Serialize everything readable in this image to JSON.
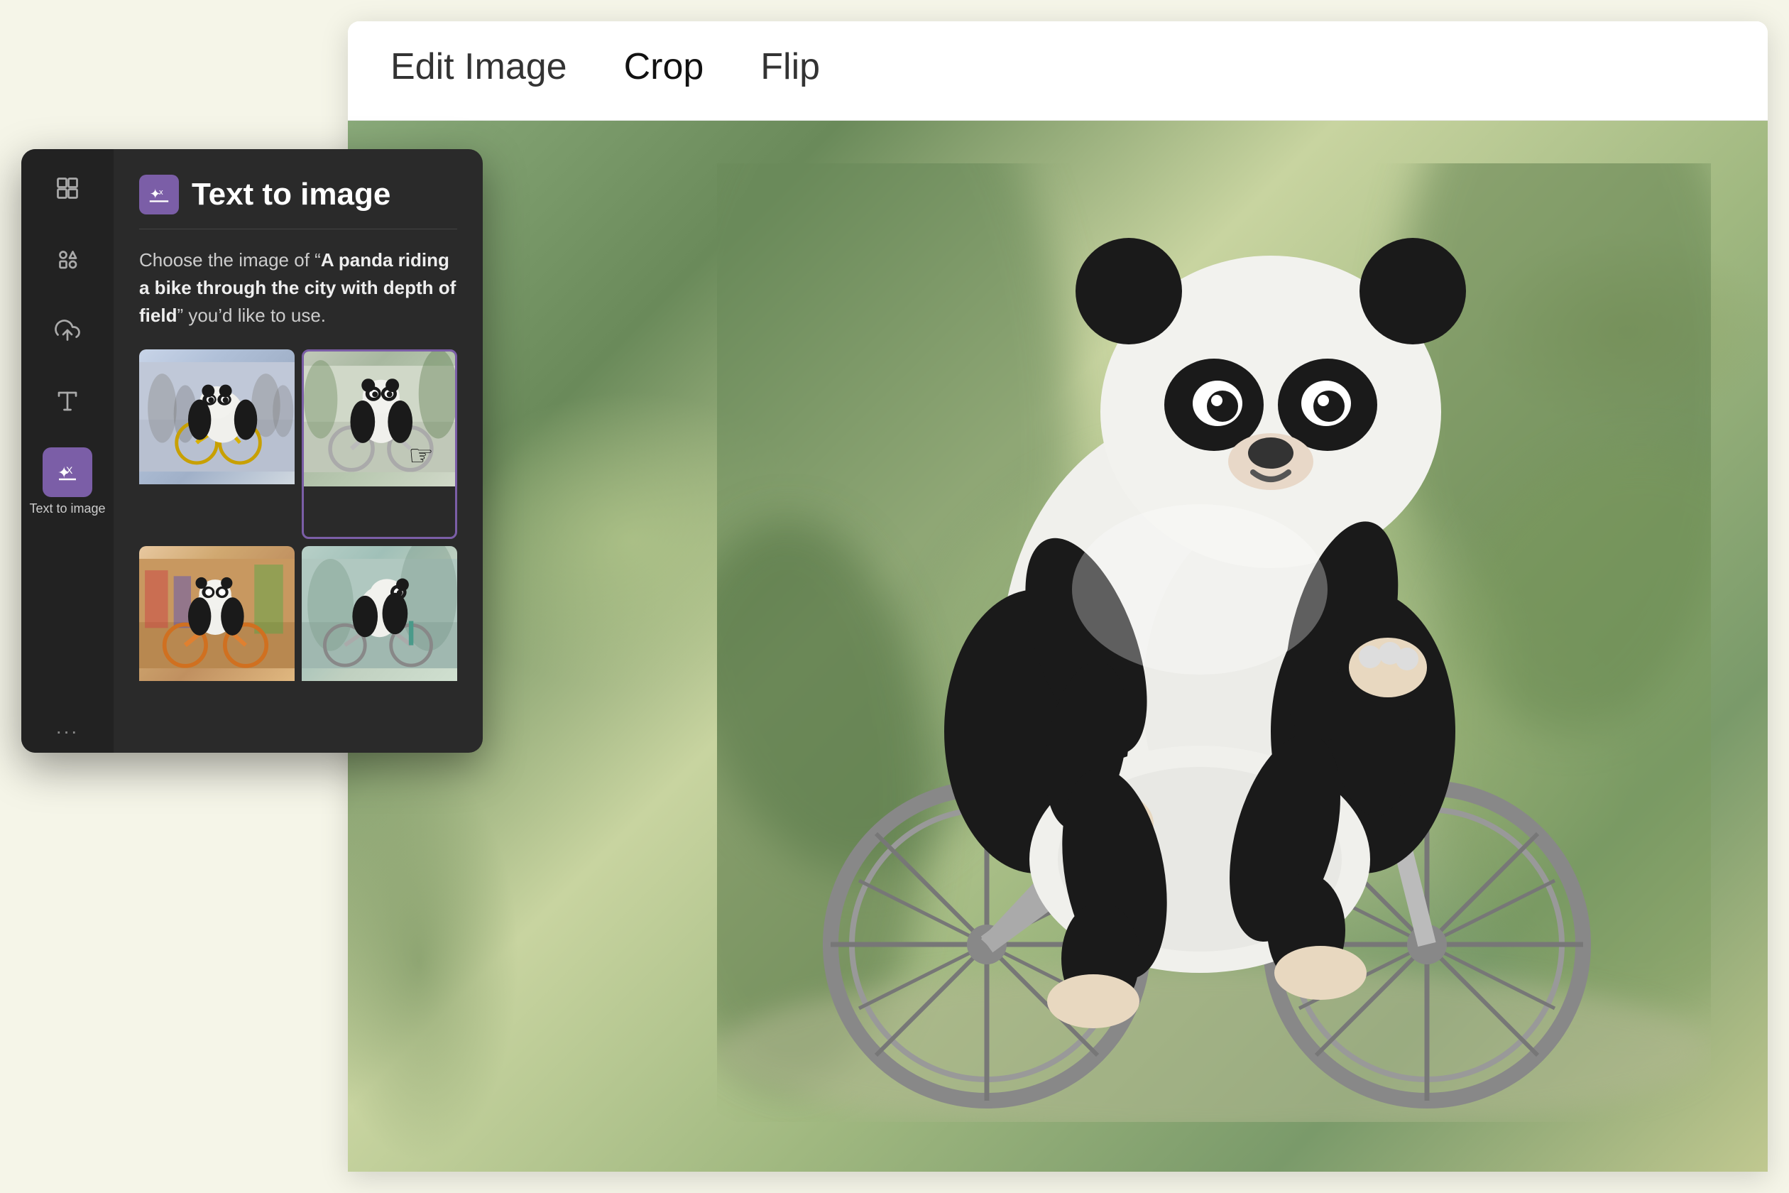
{
  "editor": {
    "tabs": [
      {
        "label": "Edit Image",
        "active": false
      },
      {
        "label": "Crop",
        "active": true
      },
      {
        "label": "Flip",
        "active": false
      }
    ]
  },
  "sidebar": {
    "title": "Text to image",
    "description_prefix": "Choose the image of “",
    "description_bold": "A panda riding a bike through the city with depth of field",
    "description_suffix": "” you’d like to use.",
    "icon_label": "Text to image",
    "dots": "...",
    "images": [
      {
        "id": 1,
        "alt": "Panda on yellow bike in city street"
      },
      {
        "id": 2,
        "alt": "Panda on silver bike, white background"
      },
      {
        "id": 3,
        "alt": "Panda on orange bike in colorful city"
      },
      {
        "id": 4,
        "alt": "Panda side view on bike in city"
      }
    ]
  },
  "main_image": {
    "alt": "Panda riding a bike - selected large view"
  }
}
